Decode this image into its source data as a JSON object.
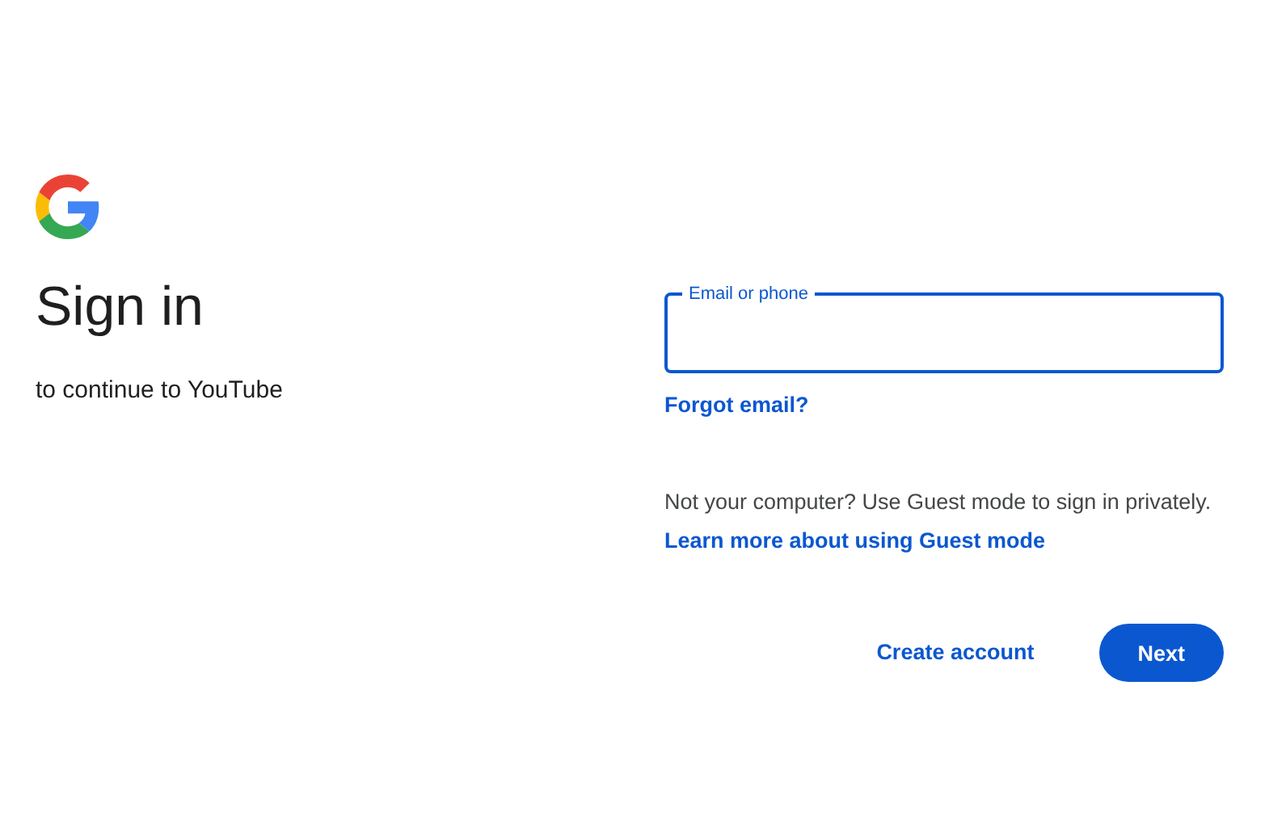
{
  "heading": {
    "title": "Sign in",
    "subtitle": "to continue to YouTube"
  },
  "email_field": {
    "label": "Email or phone",
    "focused": true
  },
  "forgot_link": "Forgot email?",
  "guest_note": {
    "text": "Not your computer? Use Guest mode to sign in privately.",
    "link": "Learn more about using Guest mode"
  },
  "buttons": [
    {
      "label": "Create account",
      "kind": "text"
    },
    {
      "label": "Next",
      "kind": "filled"
    }
  ]
}
